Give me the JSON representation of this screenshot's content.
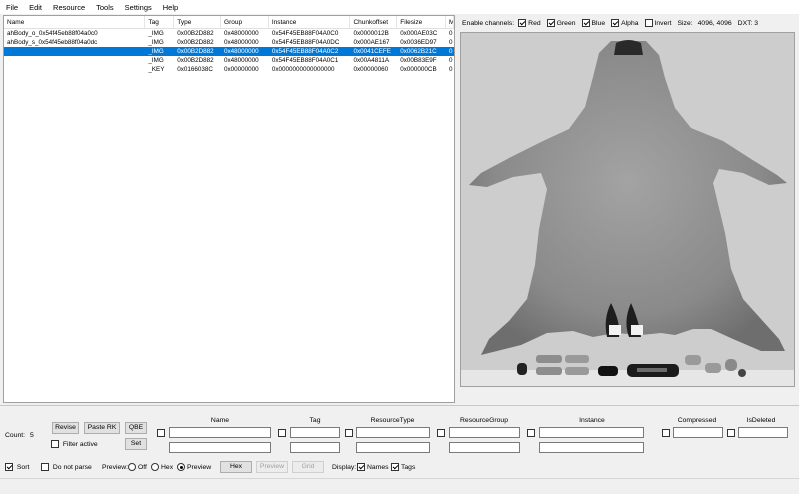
{
  "menu": [
    "File",
    "Edit",
    "Resource",
    "Tools",
    "Settings",
    "Help"
  ],
  "list": {
    "columns": [
      "Name",
      "Tag",
      "Type",
      "Group",
      "Instance",
      "Chunkoffset",
      "Filesize",
      "M"
    ],
    "rows": [
      [
        "ahBody_o_0x54f45eb88f04a0c0",
        "_IMG",
        "0x00B2D882",
        "0x48000000",
        "0x54F45EB88F04A0C0",
        "0x0000012B",
        "0x000AE03C",
        "0"
      ],
      [
        "ahBody_s_0x54f45eb88f04a0dc",
        "_IMG",
        "0x00B2D882",
        "0x48000000",
        "0x54F45EB88F04A0DC",
        "0x000AE167",
        "0x0036ED97",
        "0"
      ],
      [
        "",
        "_IMG",
        "0x00B2D882",
        "0x48000000",
        "0x54F45EB88F04A0C2",
        "0x0041CEFE",
        "0x0062B21C",
        "0"
      ],
      [
        "",
        "_IMG",
        "0x00B2D882",
        "0x48000000",
        "0x54F45EB88F04A0C1",
        "0x00A4811A",
        "0x00B83E9F",
        "0"
      ],
      [
        "",
        "_KEY",
        "0x0166038C",
        "0x00000000",
        "0x0000000000000000",
        "0x00000060",
        "0x000000CB",
        "0"
      ]
    ],
    "selected_index": 2
  },
  "channels": {
    "label": "Enable channels:",
    "items": [
      {
        "label": "Red",
        "checked": true
      },
      {
        "label": "Green",
        "checked": true
      },
      {
        "label": "Blue",
        "checked": true
      },
      {
        "label": "Alpha",
        "checked": true
      },
      {
        "label": "Invert",
        "checked": false
      }
    ],
    "size_label": "Size:",
    "size_value": "4096, 4096",
    "dxt": "DXT: 3"
  },
  "bottom": {
    "count_label": "Count:",
    "count_value": "5",
    "revise": "Revise",
    "paste_rk": "Paste RK",
    "qbe": "QBE",
    "set": "Set",
    "filter_active": "Filter active",
    "headers": [
      "Name",
      "Tag",
      "ResourceType",
      "ResourceGroup",
      "Instance",
      "Compressed",
      "IsDeleted"
    ],
    "sort": "Sort",
    "do_not_parse": "Do not parse",
    "preview_label": "Preview:",
    "preview_options": [
      "Off",
      "Hex",
      "Preview"
    ],
    "preview_selected": "Preview",
    "hex_button": "Hex",
    "preview_button": "Preview",
    "grid_button": "Grid",
    "display_label": "Display:",
    "names": "Names",
    "tags": "Tags"
  },
  "colors": {
    "selection": "#0078d7",
    "preview_bg": "#cdcdcd",
    "texture": "#8f8f8f"
  }
}
